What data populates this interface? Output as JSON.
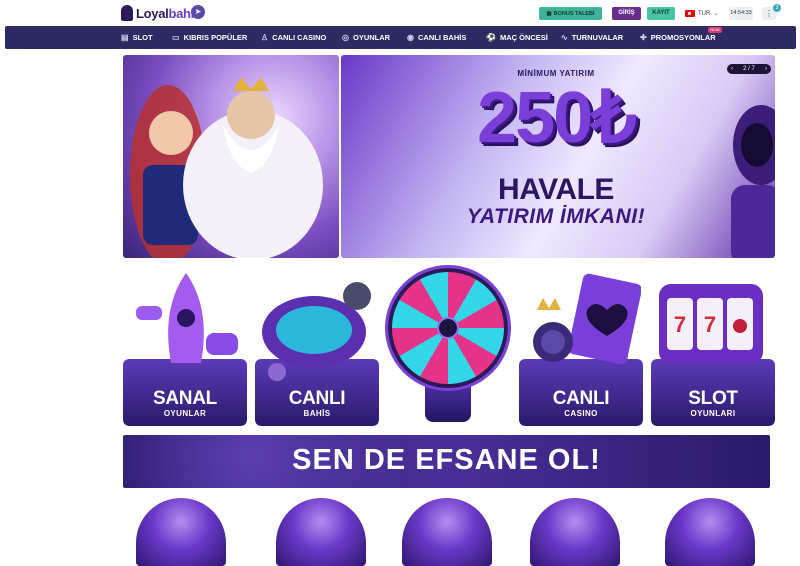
{
  "header": {
    "logo_prefix": "Loyal",
    "logo_suffix": "bahis",
    "bonus_button": "BONUS TALEBİ",
    "login_button": "GİRİŞ",
    "register_button": "KAYIT",
    "language": "TUR",
    "clock": "14:54:33",
    "notification_count": "3"
  },
  "nav": {
    "items": [
      {
        "label": "SLOT",
        "icon": "slot-icon"
      },
      {
        "label": "KIBRIS POPÜLER",
        "icon": "ticket-icon"
      },
      {
        "label": "CANLI CASINO",
        "icon": "dealer-icon"
      },
      {
        "label": "OYUNLAR",
        "icon": "game-icon"
      },
      {
        "label": "CANLI BAHİS",
        "icon": "live-icon"
      },
      {
        "label": "MAÇ ÖNCESİ",
        "icon": "ball-icon"
      },
      {
        "label": "TURNUVALAR",
        "icon": "trend-icon"
      },
      {
        "label": "PROMOSYONLAR",
        "icon": "gift-icon"
      }
    ],
    "new_badge": "NEW"
  },
  "hero": {
    "promo_top": "MİNİMUM YATIRIM",
    "promo_amount": "250₺",
    "promo_mid": "HAVALE",
    "promo_bottom": "YATIRIM İMKANI!",
    "pager_text": "2 / 7"
  },
  "categories": [
    {
      "title": "SANAL",
      "subtitle": "OYUNLAR"
    },
    {
      "title": "CANLI",
      "subtitle": "BAHİS"
    },
    {
      "title": "",
      "subtitle": ""
    },
    {
      "title": "CANLI",
      "subtitle": "CASINO"
    },
    {
      "title": "SLOT",
      "subtitle": "OYUNLARI"
    }
  ],
  "banner": {
    "text": "SEN DE EFSANE OL!"
  },
  "colors": {
    "nav_bg": "#2e2a63",
    "accent": "#7b3fd9",
    "bonus": "#3fb39a",
    "login": "#6a2d8f",
    "register": "#49c4a4"
  }
}
